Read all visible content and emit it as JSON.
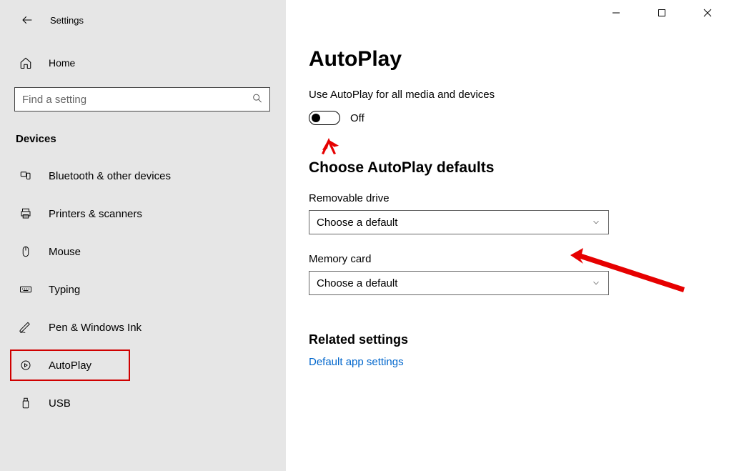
{
  "window": {
    "title": "Settings"
  },
  "sidebar": {
    "home": "Home",
    "search_placeholder": "Find a setting",
    "section": "Devices",
    "items": [
      {
        "label": "Bluetooth & other devices"
      },
      {
        "label": "Printers & scanners"
      },
      {
        "label": "Mouse"
      },
      {
        "label": "Typing"
      },
      {
        "label": "Pen & Windows Ink"
      },
      {
        "label": "AutoPlay"
      },
      {
        "label": "USB"
      }
    ]
  },
  "main": {
    "title": "AutoPlay",
    "toggle_caption": "Use AutoPlay for all media and devices",
    "toggle_state": "Off",
    "defaults_heading": "Choose AutoPlay defaults",
    "removable_label": "Removable drive",
    "removable_value": "Choose a default",
    "memory_label": "Memory card",
    "memory_value": "Choose a default",
    "related_heading": "Related settings",
    "related_link": "Default app settings"
  }
}
